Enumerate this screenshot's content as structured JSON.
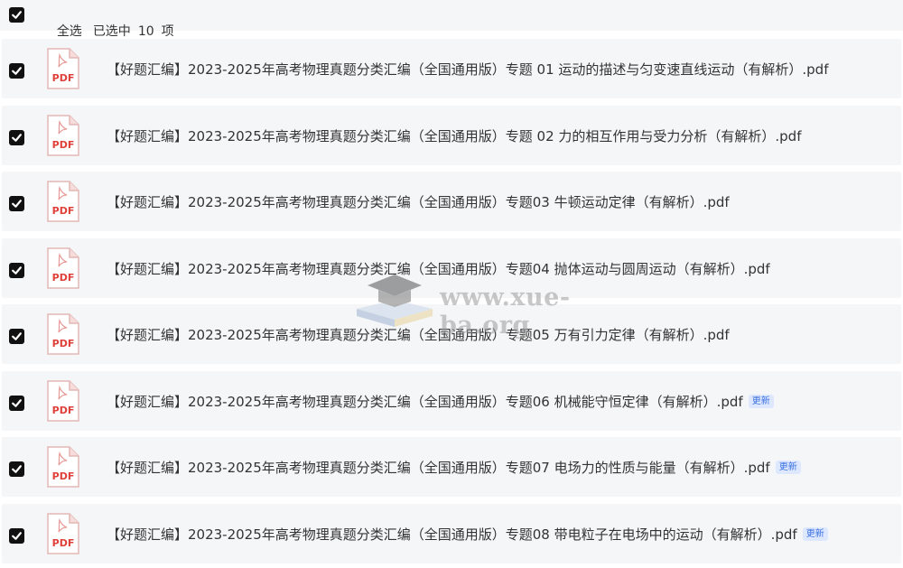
{
  "header": {
    "select_all": "全选",
    "selected_prefix": "已选中",
    "count": "10",
    "unit": "项"
  },
  "files": [
    {
      "name": "【好题汇编】2023-2025年高考物理真题分类汇编（全国通用版）专题 01 运动的描述与匀变速直线运动（有解析）.pdf",
      "badge": ""
    },
    {
      "name": "【好题汇编】2023-2025年高考物理真题分类汇编（全国通用版）专题 02 力的相互作用与受力分析（有解析）.pdf",
      "badge": ""
    },
    {
      "name": "【好题汇编】2023-2025年高考物理真题分类汇编（全国通用版）专题03 牛顿运动定律（有解析）.pdf",
      "badge": ""
    },
    {
      "name": "【好题汇编】2023-2025年高考物理真题分类汇编（全国通用版）专题04  抛体运动与圆周运动（有解析）.pdf",
      "badge": ""
    },
    {
      "name": "【好题汇编】2023-2025年高考物理真题分类汇编（全国通用版）专题05  万有引力定律（有解析）.pdf",
      "badge": ""
    },
    {
      "name": "【好题汇编】2023-2025年高考物理真题分类汇编（全国通用版）专题06  机械能守恒定律（有解析）.pdf",
      "badge": "更新"
    },
    {
      "name": "【好题汇编】2023-2025年高考物理真题分类汇编（全国通用版）专题07  电场力的性质与能量（有解析）.pdf",
      "badge": "更新"
    },
    {
      "name": "【好题汇编】2023-2025年高考物理真题分类汇编（全国通用版）专题08  带电粒子在电场中的运动（有解析）.pdf",
      "badge": "更新"
    }
  ],
  "icon": {
    "label": "PDF",
    "name": "pdf-file-icon",
    "color": "#e0403a"
  },
  "watermark": "www.xue-ba.org",
  "colors": {
    "row_bg": "#f5f6f8",
    "badge_bg": "#dde8ff",
    "badge_text": "#3b6fe0"
  }
}
